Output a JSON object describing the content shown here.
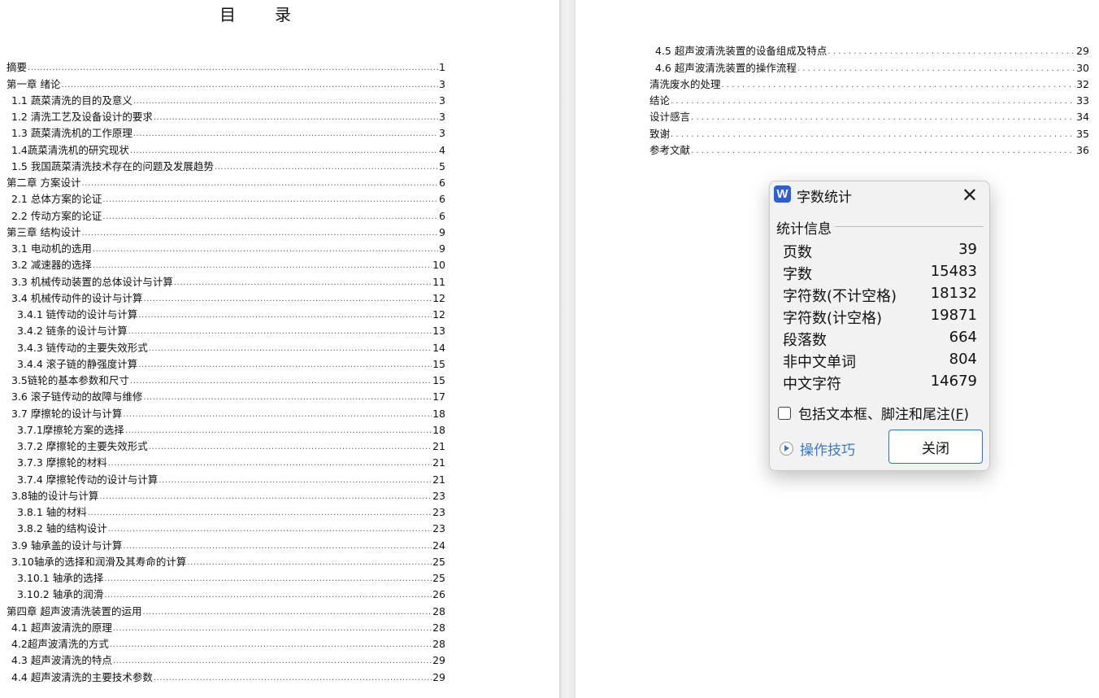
{
  "document": {
    "toc_title_chars": [
      "目",
      "录"
    ],
    "left_page_entries": [
      {
        "text": "摘要",
        "page": "1",
        "level": 0
      },
      {
        "text": "第一章  绪论",
        "page": "3",
        "level": 0
      },
      {
        "text": "1.1 蔬菜清洗的目的及意义",
        "page": "3",
        "level": 1
      },
      {
        "text": "1.2 清洗工艺及设备设计的要求",
        "page": "3",
        "level": 1
      },
      {
        "text": "1.3 蔬菜清洗机的工作原理",
        "page": "3",
        "level": 1
      },
      {
        "text": "1.4蔬菜清洗机的研究现状",
        "page": "4",
        "level": 1
      },
      {
        "text": "1.5 我国蔬菜清洗技术存在的问题及发展趋势",
        "page": "5",
        "level": 1
      },
      {
        "text": "第二章  方案设计",
        "page": "6",
        "level": 0
      },
      {
        "text": "2.1 总体方案的论证",
        "page": "6",
        "level": 1
      },
      {
        "text": "2.2 传动方案的论证",
        "page": "6",
        "level": 1
      },
      {
        "text": "第三章  结构设计",
        "page": "9",
        "level": 0
      },
      {
        "text": "3.1 电动机的选用",
        "page": "9",
        "level": 1
      },
      {
        "text": "3.2 减速器的选择",
        "page": "10",
        "level": 1
      },
      {
        "text": "3.3 机械传动装置的总体设计与计算",
        "page": "11",
        "level": 1
      },
      {
        "text": "3.4 机械传动件的设计与计算",
        "page": "12",
        "level": 1
      },
      {
        "text": "3.4.1 链传动的设计与计算",
        "page": "12",
        "level": 2
      },
      {
        "text": "3.4.2 链条的设计与计算",
        "page": "13",
        "level": 2
      },
      {
        "text": "3.4.3 链传动的主要失效形式",
        "page": "14",
        "level": 2
      },
      {
        "text": "3.4.4 滚子链的静强度计算",
        "page": "15",
        "level": 2
      },
      {
        "text": "3.5链轮的基本参数和尺寸",
        "page": "15",
        "level": 1
      },
      {
        "text": "3.6 滚子链传动的故障与维修",
        "page": "17",
        "level": 1
      },
      {
        "text": "3.7 摩擦轮的设计与计算",
        "page": "18",
        "level": 1
      },
      {
        "text": "3.7.1摩擦轮方案的选择",
        "page": "18",
        "level": 2
      },
      {
        "text": "3.7.2 摩擦轮的主要失效形式",
        "page": "21",
        "level": 2
      },
      {
        "text": "3.7.3 摩擦轮的材料",
        "page": "21",
        "level": 2
      },
      {
        "text": "3.7.4 摩擦轮传动的设计与计算",
        "page": "21",
        "level": 2
      },
      {
        "text": "3.8轴的设计与计算",
        "page": "23",
        "level": 1
      },
      {
        "text": "3.8.1 轴的材料",
        "page": "23",
        "level": 2
      },
      {
        "text": "3.8.2 轴的结构设计",
        "page": "23",
        "level": 2
      },
      {
        "text": "3.9 轴承盖的设计与计算",
        "page": "24",
        "level": 1
      },
      {
        "text": "3.10轴承的选择和润滑及其寿命的计算",
        "page": "25",
        "level": 1
      },
      {
        "text": "3.10.1 轴承的选择",
        "page": "25",
        "level": 2
      },
      {
        "text": "3.10.2 轴承的润滑",
        "page": "26",
        "level": 2
      },
      {
        "text": "第四章  超声波清洗装置的运用",
        "page": "28",
        "level": 0
      },
      {
        "text": "4.1 超声波清洗的原理",
        "page": "28",
        "level": 1
      },
      {
        "text": "4.2超声波清洗的方式",
        "page": "28",
        "level": 1
      },
      {
        "text": "4.3 超声波清洗的特点",
        "page": "29",
        "level": 1
      },
      {
        "text": "4.4 超声波清洗的主要技术参数",
        "page": "29",
        "level": 1
      }
    ],
    "right_page_entries": [
      {
        "text": "4.5 超声波清洗装置的设备组成及特点",
        "page": "29",
        "level": 1
      },
      {
        "text": "4.6 超声波清洗装置的操作流程",
        "page": "30",
        "level": 1
      },
      {
        "text": "清洗废水的处理",
        "page": "32",
        "level": 0
      },
      {
        "text": "结论",
        "page": "33",
        "level": 0
      },
      {
        "text": "设计感言",
        "page": "34",
        "level": 0
      },
      {
        "text": "致谢",
        "page": "35",
        "level": 0
      },
      {
        "text": "参考文献",
        "page": "36",
        "level": 0
      }
    ]
  },
  "dialog": {
    "logo_letter": "W",
    "title": "字数统计",
    "close_icon": "close-icon",
    "section_label": "统计信息",
    "stats": [
      {
        "label": "页数",
        "value": "39"
      },
      {
        "label": "字数",
        "value": "15483"
      },
      {
        "label": "字符数(不计空格)",
        "value": "18132"
      },
      {
        "label": "字符数(计空格)",
        "value": "19871"
      },
      {
        "label": "段落数",
        "value": "664"
      },
      {
        "label": "非中文单词",
        "value": "804"
      },
      {
        "label": "中文字符",
        "value": "14679"
      }
    ],
    "include_label": "包括文本框、脚注和尾注(",
    "include_shortcut": "F",
    "include_label_end": ")",
    "include_checked": false,
    "tips_label": "操作技巧",
    "close_button_label": "关闭",
    "accent_color": "#2f6fd0",
    "link_color": "#3a78c9"
  }
}
